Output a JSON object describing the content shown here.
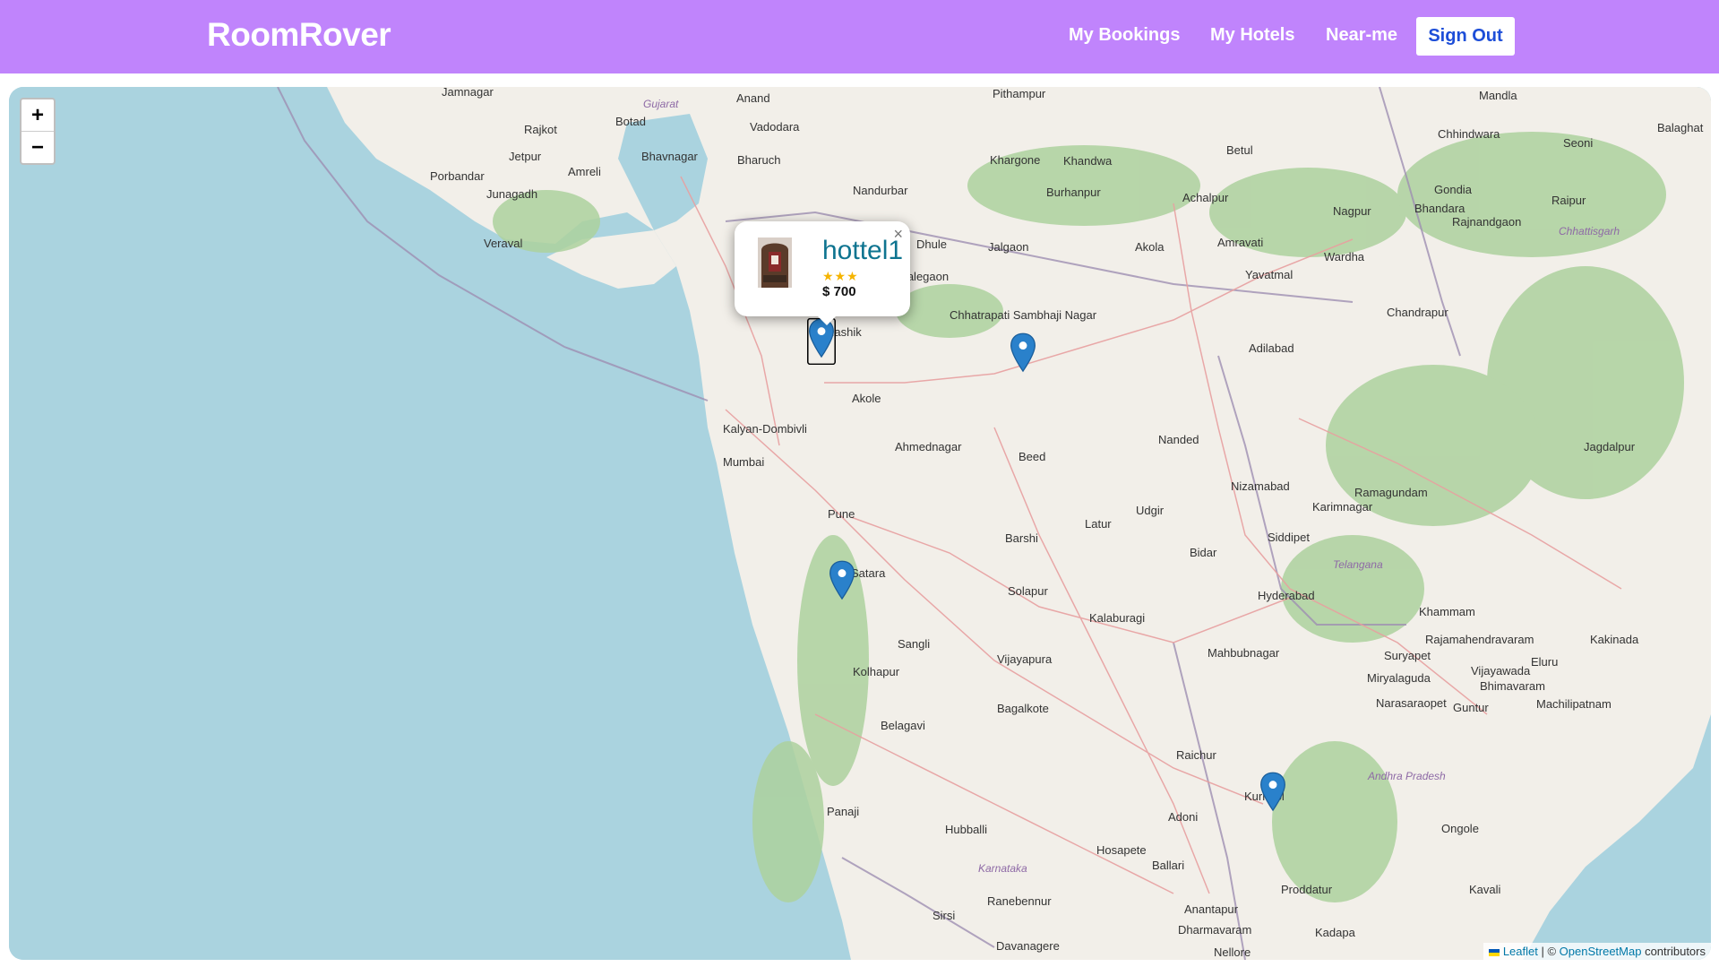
{
  "app": {
    "title": "RoomRover"
  },
  "nav": {
    "links": [
      "My Bookings",
      "My Hotels",
      "Near-me"
    ],
    "signout": "Sign Out"
  },
  "map": {
    "zoom_in": "+",
    "zoom_out": "−",
    "attribution": {
      "leaflet": "Leaflet",
      "separator": " | © ",
      "osm": "OpenStreetMap",
      "suffix": " contributors"
    },
    "popup": {
      "close": "×",
      "name": "hottel1",
      "stars": "★★★",
      "price": "$ 700"
    },
    "colors": {
      "sea": "#aad3df",
      "land": "#f2efe9",
      "forest": "#add19e",
      "marker": "#2a81cb",
      "navbar": "#c084fc"
    },
    "cities": [
      "Jamnagar",
      "Anand",
      "Pithampur",
      "Mandla",
      "Rajkot",
      "Botad",
      "Vadodara",
      "Khargone",
      "Khandwa",
      "Chhindwara",
      "Seoni",
      "Balaghat",
      "Gujarat",
      "Bhavnagar",
      "Porbandar",
      "Jetpur",
      "Amreli",
      "Bharuch",
      "Nandurbar",
      "Burhanpur",
      "Betul",
      "Achalpur",
      "Gondia",
      "Junagadh",
      "Veraval",
      "Jalgaon",
      "Akola",
      "Amravati",
      "Nagpur",
      "Bhandara",
      "Raipur",
      "Dhule",
      "Malegaon",
      "Wardha",
      "Rajnandgaon",
      "Chhattisgarh",
      "Yavatmal",
      "Chhatrapati Sambhaji Nagar",
      "Nashik",
      "Akole",
      "Adilabad",
      "Chandrapur",
      "Kalyan-Dombivli",
      "Mumbai",
      "Ahmednagar",
      "Beed",
      "Nanded",
      "Jagdalpur",
      "Nizamabad",
      "Ramagundam",
      "Karimnagar",
      "Pune",
      "Udgir",
      "Latur",
      "Barshi",
      "Siddipet",
      "Bidar",
      "Telangana",
      "Satara",
      "Solapur",
      "Hyderabad",
      "Kalaburagi",
      "Khammam",
      "Sangli",
      "Kolhapur",
      "Vijayapura",
      "Mahbubnagar",
      "Suryapet",
      "Miryalaguda",
      "Rajamahendravaram",
      "Kakinada",
      "Vijayawada",
      "Eluru",
      "Bhimavaram",
      "Bagalkote",
      "Belagavi",
      "Narasaraopet",
      "Guntur",
      "Machilipatnam",
      "Raichur",
      "Andhra Pradesh",
      "Panaji",
      "Hubballi",
      "Kurnool",
      "Adoni",
      "Ongole",
      "Hosapete",
      "Ballari",
      "Karnataka",
      "Kavali",
      "Proddatur",
      "Ranebennur",
      "Anantapur",
      "Sirsi",
      "Dharmavaram",
      "Kadapa",
      "Davanagere",
      "Nellore"
    ]
  }
}
